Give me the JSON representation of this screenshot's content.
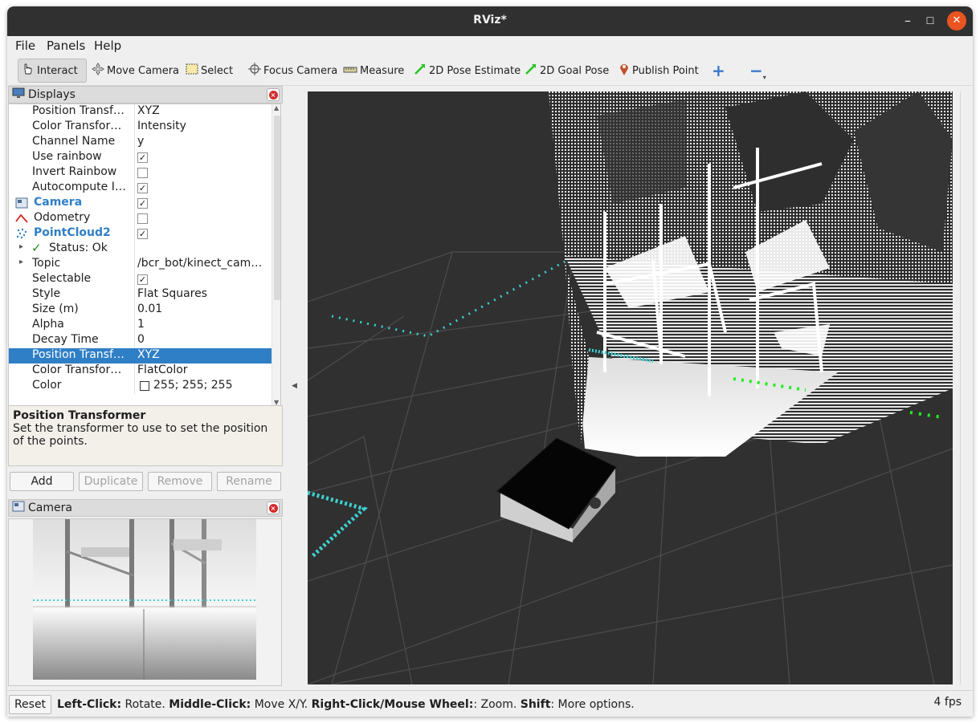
{
  "window": {
    "title": "RViz*"
  },
  "menu": [
    "File",
    "Panels",
    "Help"
  ],
  "toolbar": {
    "interact": "Interact",
    "move_camera": "Move Camera",
    "select": "Select",
    "focus_camera": "Focus Camera",
    "measure": "Measure",
    "pose_estimate": "2D Pose Estimate",
    "goal_pose": "2D Goal Pose",
    "publish_point": "Publish Point"
  },
  "displays": {
    "title": "Displays",
    "rows": [
      {
        "label": "Position Transf…",
        "value": "XYZ"
      },
      {
        "label": "Color Transfor…",
        "value": "Intensity"
      },
      {
        "label": "Channel Name",
        "value": "y"
      },
      {
        "label": "Use rainbow",
        "value": "",
        "checked": true
      },
      {
        "label": "Invert Rainbow",
        "value": "",
        "checked": false
      },
      {
        "label": "Autocompute I…",
        "value": "",
        "checked": true
      },
      {
        "label": "Camera",
        "value": "",
        "checked": true
      },
      {
        "label": "Odometry",
        "value": "",
        "checked": false
      },
      {
        "label": "PointCloud2",
        "value": "",
        "checked": true
      },
      {
        "label": "Status: Ok",
        "value": ""
      },
      {
        "label": "Topic",
        "value": "/bcr_bot/kinect_cam…"
      },
      {
        "label": "Selectable",
        "value": "",
        "checked": true
      },
      {
        "label": "Style",
        "value": "Flat Squares"
      },
      {
        "label": "Size (m)",
        "value": "0.01"
      },
      {
        "label": "Alpha",
        "value": "1"
      },
      {
        "label": "Decay Time",
        "value": "0"
      },
      {
        "label": "Position Transf…",
        "value": "XYZ"
      },
      {
        "label": "Color Transfor…",
        "value": "FlatColor"
      },
      {
        "label": "Color",
        "value": "255; 255; 255"
      }
    ]
  },
  "description": {
    "title": "Position Transformer",
    "text": "Set the transformer to use to set the position of the points."
  },
  "buttons": {
    "add": "Add",
    "duplicate": "Duplicate",
    "remove": "Remove",
    "rename": "Rename"
  },
  "camera_panel": {
    "title": "Camera"
  },
  "statusbar": {
    "reset": "Reset",
    "hint_1_b": "Left-Click:",
    "hint_1": " Rotate. ",
    "hint_2_b": "Middle-Click:",
    "hint_2": " Move X/Y. ",
    "hint_3_b": "Right-Click/Mouse Wheel:",
    "hint_3": ": Zoom. ",
    "hint_4_b": "Shift",
    "hint_4": ": More options.",
    "fps": "4 fps"
  },
  "colors": {
    "accent": "#2f7fc6",
    "close": "#e95420",
    "grid": "#4a4a4a",
    "path": "#3fd0d0",
    "green": "#22ee22"
  }
}
